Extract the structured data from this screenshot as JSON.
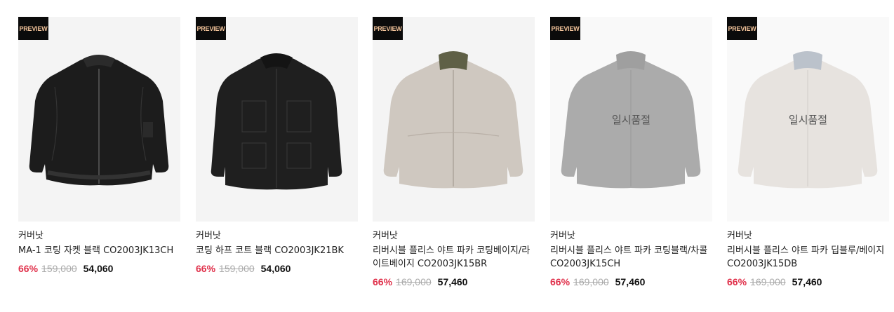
{
  "products": [
    {
      "badge": "PREVIEW",
      "brand": "커버낫",
      "name": "MA-1 코팅 자켓 블랙 CO2003JK13CH",
      "discount": "66%",
      "original_price": "159,000",
      "sale_price": "54,060",
      "soldout_label": "",
      "color": "#1c1c1c"
    },
    {
      "badge": "PREVIEW",
      "brand": "커버낫",
      "name": "코팅 하프 코트 블랙 CO2003JK21BK",
      "discount": "66%",
      "original_price": "159,000",
      "sale_price": "54,060",
      "soldout_label": "",
      "color": "#1f1f1f"
    },
    {
      "badge": "PREVIEW",
      "brand": "커버낫",
      "name": "리버시블 플리스 야트 파카 코팅베이지/라이트베이지 CO2003JK15BR",
      "discount": "66%",
      "original_price": "169,000",
      "sale_price": "57,460",
      "soldout_label": "",
      "color": "#cfc8c0"
    },
    {
      "badge": "PREVIEW",
      "brand": "커버낫",
      "name": "리버시블 플리스 야트 파카 코팅블랙/차콜 CO2003JK15CH",
      "discount": "66%",
      "original_price": "169,000",
      "sale_price": "57,460",
      "soldout_label": "일시품절",
      "color": "#6f6f6f"
    },
    {
      "badge": "PREVIEW",
      "brand": "커버낫",
      "name": "리버시블 플리스 야트 파카 딥블루/베이지 CO2003JK15DB",
      "discount": "66%",
      "original_price": "169,000",
      "sale_price": "57,460",
      "soldout_label": "일시품절",
      "color": "#d6cfc9"
    }
  ],
  "colors": {
    "accent_discount": "#e0314b",
    "badge_bg": "#0b0b0b",
    "badge_text": "#f2c39a"
  }
}
